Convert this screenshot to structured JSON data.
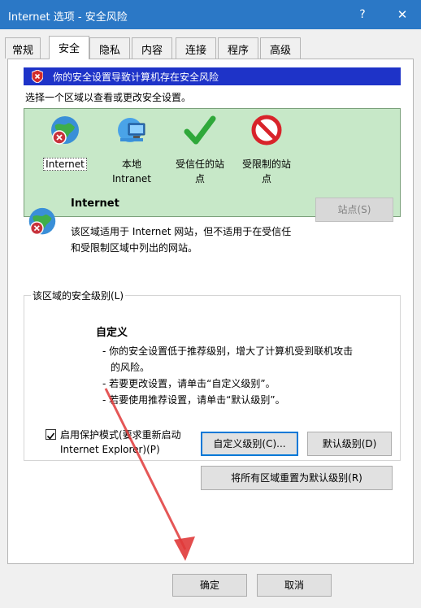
{
  "window": {
    "title": "Internet 选项 - 安全风险",
    "help_label": "?",
    "close_label": "✕"
  },
  "tabs": [
    {
      "label": "常规"
    },
    {
      "label": "安全",
      "active": true
    },
    {
      "label": "隐私"
    },
    {
      "label": "内容"
    },
    {
      "label": "连接"
    },
    {
      "label": "程序"
    },
    {
      "label": "高级"
    }
  ],
  "warning_bar": {
    "text": "你的安全设置导致计算机存在安全风险"
  },
  "zone_prompt": "选择一个区域以查看或更改安全设置。",
  "zones": [
    {
      "line1": "Internet",
      "line2": "",
      "icon": "globe-warning-icon",
      "selected": true
    },
    {
      "line1": "本地",
      "line2": "Intranet",
      "icon": "computer-network-icon"
    },
    {
      "line1": "受信任的站",
      "line2": "点",
      "icon": "green-check-icon"
    },
    {
      "line1": "受限制的站",
      "line2": "点",
      "icon": "red-prohibited-icon"
    }
  ],
  "zone_info": {
    "title": "Internet",
    "description_line1": "该区域适用于 Internet 网站，但不适用于在受信任",
    "description_line2": "和受限制区域中列出的网站。",
    "sites_button": "站点(S)"
  },
  "security_level": {
    "group_title": "该区域的安全级别(L)",
    "level_name": "自定义",
    "lines": [
      "- 你的安全设置低于推荐级别，增大了计算机受到联机攻击",
      "  的风险。",
      "- 若要更改设置，请单击“自定义级别”。",
      "- 若要使用推荐设置，请单击“默认级别”。"
    ],
    "protected_mode_line1": "启用保护模式(要求重新启动",
    "protected_mode_line2": "Internet Explorer)(P)",
    "protected_mode_checked": true,
    "custom_level_button": "自定义级别(C)...",
    "default_level_button": "默认级别(D)"
  },
  "reset_all_button": "将所有区域重置为默认级别(R)",
  "footer": {
    "ok_label": "确定",
    "cancel_label": "取消"
  },
  "colors": {
    "titlebar": "#2b78c6",
    "warning_bar": "#1e33c8",
    "zone_background": "#c7e8c8",
    "annotation_arrow": "#e03a3a"
  }
}
